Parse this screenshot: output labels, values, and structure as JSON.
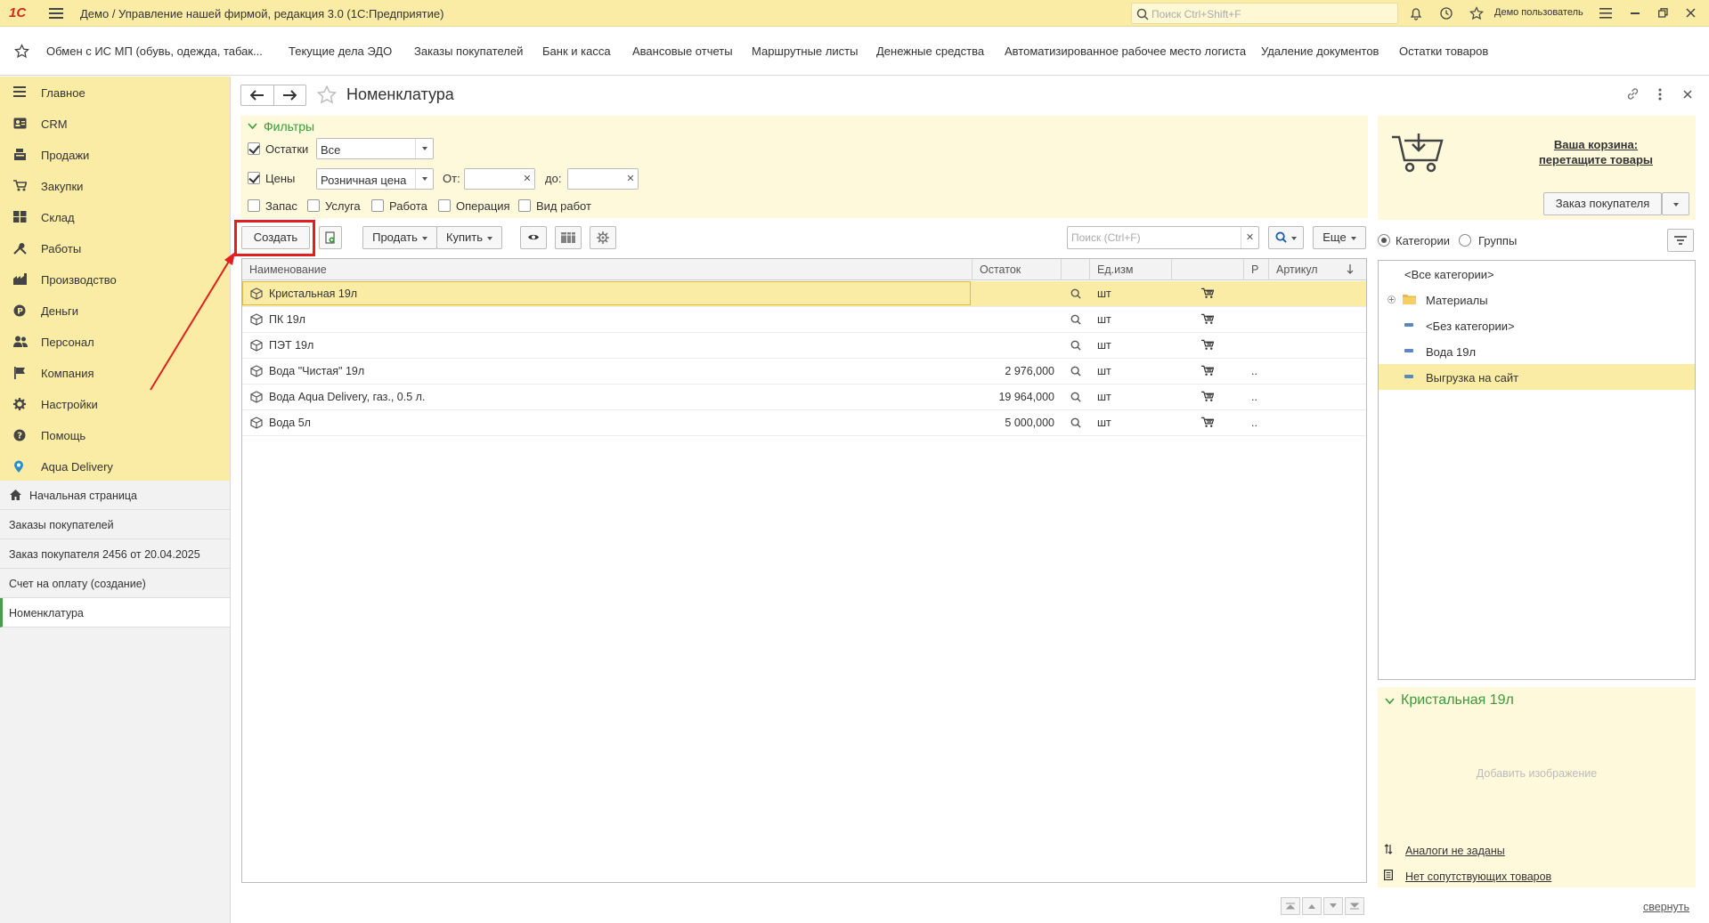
{
  "titlebar": {
    "logo": "1С",
    "title": "Демо / Управление нашей фирмой, редакция 3.0  (1С:Предприятие)",
    "search_placeholder": "Поиск Ctrl+Shift+F",
    "user": "Демо пользователь"
  },
  "sections": [
    "Обмен с ИС МП (обувь, одежда, табак...",
    "Текущие дела ЭДО",
    "Заказы покупателей",
    "Банк и касса",
    "Авансовые отчеты",
    "Маршрутные листы",
    "Денежные средства",
    "Автоматизированное рабочее место логиста",
    "Удаление документов",
    "Остатки товаров"
  ],
  "sidebar": {
    "items": [
      {
        "label": "Главное",
        "icon": "menu-lines-icon"
      },
      {
        "label": "CRM",
        "icon": "contact-card-icon"
      },
      {
        "label": "Продажи",
        "icon": "cash-register-icon"
      },
      {
        "label": "Закупки",
        "icon": "cart-icon"
      },
      {
        "label": "Склад",
        "icon": "warehouse-icon"
      },
      {
        "label": "Работы",
        "icon": "tools-icon"
      },
      {
        "label": "Производство",
        "icon": "factory-icon"
      },
      {
        "label": "Деньги",
        "icon": "coin-icon"
      },
      {
        "label": "Персонал",
        "icon": "people-icon"
      },
      {
        "label": "Компания",
        "icon": "flag-icon"
      },
      {
        "label": "Настройки",
        "icon": "gear-icon"
      },
      {
        "label": "Помощь",
        "icon": "help-icon"
      },
      {
        "label": "Aqua Delivery",
        "icon": "location-pin-icon"
      }
    ],
    "opened": [
      {
        "label": "Начальная страница"
      },
      {
        "label": "Заказы покупателей"
      },
      {
        "label": "Заказ покупателя 2456 от 20.04.2025"
      },
      {
        "label": "Счет на оплату (создание)"
      },
      {
        "label": "Номенклатура"
      }
    ]
  },
  "page": {
    "title": "Номенклатура"
  },
  "filters": {
    "header": "Фильтры",
    "stock_label": "Остатки",
    "stock_value": "Все",
    "prices_label": "Цены",
    "prices_value": "Розничная цена",
    "from_label": "От:",
    "to_label": "до:",
    "types": [
      "Запас",
      "Услуга",
      "Работа",
      "Операция",
      "Вид работ"
    ]
  },
  "toolbar": {
    "create": "Создать",
    "sell": "Продать",
    "buy": "Купить",
    "search_placeholder": "Поиск (Ctrl+F)",
    "more": "Еще"
  },
  "table": {
    "headers": [
      "Наименование",
      "Остаток",
      "Ед.изм",
      "Р",
      "Артикул"
    ],
    "rows": [
      {
        "name": "Кристальная 19л",
        "stock": "",
        "unit": "шт",
        "p": ""
      },
      {
        "name": "ПК 19л",
        "stock": "",
        "unit": "шт",
        "p": ""
      },
      {
        "name": "ПЭТ 19л",
        "stock": "",
        "unit": "шт",
        "p": ""
      },
      {
        "name": "Вода \"Чистая\" 19л",
        "stock": "2 976,000",
        "unit": "шт",
        "p": ".."
      },
      {
        "name": "Вода Aqua Delivery, газ., 0.5 л.",
        "stock": "19 964,000",
        "unit": "шт",
        "p": ".."
      },
      {
        "name": "Вода 5л",
        "stock": "5 000,000",
        "unit": "шт",
        "p": ".."
      }
    ]
  },
  "cart": {
    "line1": "Ваша корзина:",
    "line2": "перетащите товары",
    "order_button": "Заказ покупателя"
  },
  "view": {
    "categories": "Категории",
    "groups": "Группы"
  },
  "tree": [
    {
      "label": "<Все категории>"
    },
    {
      "label": "Материалы"
    },
    {
      "label": "<Без категории>"
    },
    {
      "label": "Вода 19л"
    },
    {
      "label": "Выгрузка на сайт"
    }
  ],
  "details": {
    "title": "Кристальная 19л",
    "add_image": "Добавить изображение",
    "analogs": "Аналоги не заданы",
    "related": "Нет сопутствующих товаров",
    "collapse": "свернуть"
  },
  "colors": {
    "accent_yellow": "#fbeca5",
    "green": "#3a9a3a",
    "annotation_red": "#e02020"
  }
}
